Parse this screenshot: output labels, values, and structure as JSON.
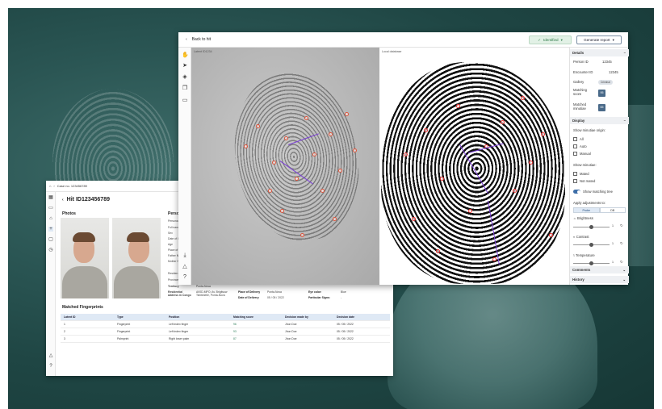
{
  "background": {
    "accent": "#2a5553"
  },
  "hit_window": {
    "breadcrumb": "Case no. 123456789",
    "title": "Hit ID123456789",
    "photos_heading": "Photos",
    "person_heading": "Perso",
    "person_fields": [
      "Persona",
      "Full nam",
      "Sex",
      "Date of I",
      "Age",
      "Place of",
      "Father N",
      "Mother N",
      "Residen",
      "Province",
      "Territory",
      "Residential address in Congo"
    ],
    "person_values": {
      "territory": "Ponta-Nova",
      "address": "AV0D-MPO, Av. Brigitsow Tshitshelle, Ponta-Nova",
      "place_of_delivery_label": "Place of Delivery",
      "place_of_delivery": "Ponta-Nova",
      "date_of_delivery_label": "Date of Delivery",
      "date_of_delivery": "05 / 05 / 2022",
      "eye_color_label": "Eye color:",
      "eye_color": "Blue",
      "particular_signs_label": "Particular Signs:",
      "particular_signs": "-"
    },
    "matched_heading": "Matched Fingerprints",
    "table": {
      "columns": [
        "Latent ID",
        "Type",
        "Position",
        "Matching score",
        "Decision made by",
        "Decision date"
      ],
      "rows": [
        [
          "1",
          "Fingerprint",
          "Left index finger",
          "96",
          "Jhon Doe",
          "05 / 05 / 2022"
        ],
        [
          "2",
          "Fingerprint",
          "Left index finger",
          "93",
          "Jhon Doe",
          "05 / 05 / 2022"
        ],
        [
          "3",
          "Palmprint",
          "Right lower palm",
          "87",
          "Jhon Doe",
          "05 / 05 / 2022"
        ]
      ]
    }
  },
  "compare_window": {
    "back_label": "Back to hit",
    "identified_label": "Identified",
    "generate_label": "Generate report",
    "latent_label": "Latent ID1234",
    "local_label": "Local database",
    "details": {
      "heading": "Details",
      "person_id_label": "Person ID",
      "person_id": "12345",
      "encounter_id_label": "Encounter ID",
      "encounter_id": "12345",
      "gallery_label": "Gallery",
      "gallery_value": "Criminal",
      "matching_score_label": "Matching score",
      "matching_score": "95",
      "matched_minutiae_label": "Matched minutiae",
      "matched_minutiae": "65"
    },
    "display": {
      "heading": "Display",
      "origin_label": "Show minutiae origin:",
      "origin_options": [
        "All",
        "Auto",
        "Manual"
      ],
      "show_label": "Show minutiae:",
      "show_options": [
        "Mated",
        "Not mated"
      ],
      "tree_label": "Show matching tree",
      "adjust_label": "Apply adjustments to:",
      "adjust_options": [
        "Probe",
        "DB"
      ],
      "brightness_label": "Brightness",
      "brightness_value": "1",
      "contrast_label": "Contrast",
      "contrast_value": "1",
      "temperature_label": "Temperature",
      "temperature_value": "1"
    },
    "comments_heading": "Comments",
    "history_heading": "History"
  }
}
